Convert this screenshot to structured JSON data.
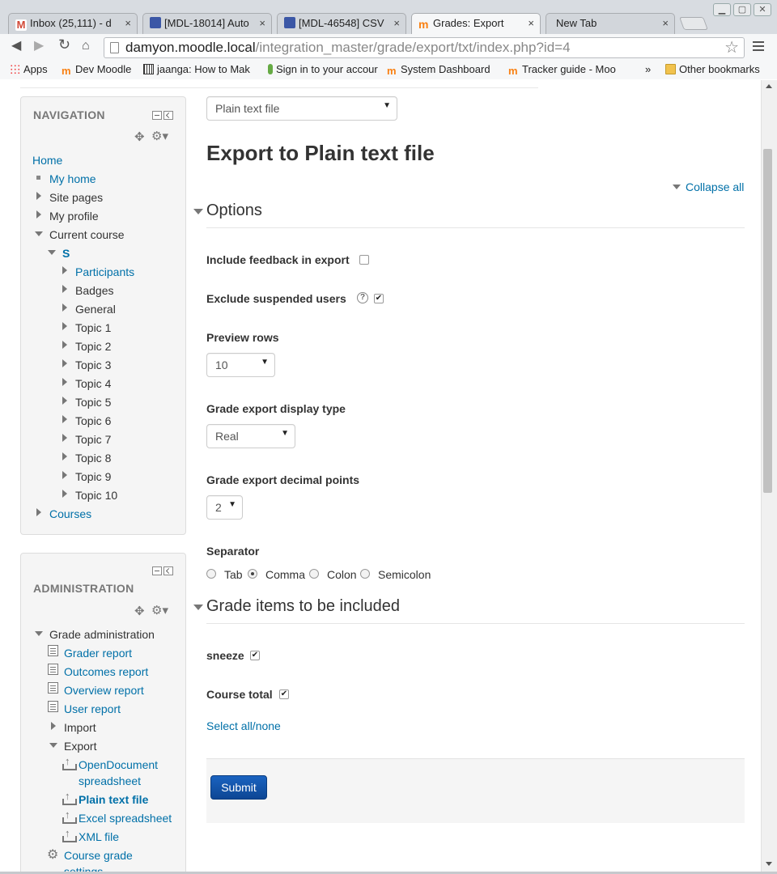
{
  "browser": {
    "tabs": [
      {
        "label": "Inbox (25,111) - d",
        "icon": "gmail-icon",
        "close": "×"
      },
      {
        "label": "[MDL-18014] Auto",
        "icon": "tracker-icon",
        "close": "×"
      },
      {
        "label": "[MDL-46548] CSV",
        "icon": "tracker-icon",
        "close": "×"
      },
      {
        "label": "Grades: Export",
        "icon": "moodle-icon",
        "close": "×"
      },
      {
        "label": "New Tab",
        "icon": "",
        "close": "×"
      }
    ],
    "url_host": "damyon.moodle.local",
    "url_path": "/integration_master/grade/export/txt/index.php?id=4",
    "bookmarks": [
      {
        "label": "Apps",
        "icon": "apps-icon"
      },
      {
        "label": "Dev Moodle",
        "icon": "moodle-icon"
      },
      {
        "label": "jaanga: How to Mak",
        "icon": "barcode-icon"
      },
      {
        "label": "Sign in to your accour",
        "icon": "key-icon"
      },
      {
        "label": "System Dashboard",
        "icon": "moodle-icon"
      },
      {
        "label": "Tracker guide - Moo",
        "icon": "moodle-icon"
      }
    ],
    "bookmarks_overflow": "»",
    "other_bookmarks": "Other bookmarks"
  },
  "navigation": {
    "title": "NAVIGATION",
    "home": "Home",
    "my_home": "My home",
    "site_pages": "Site pages",
    "my_profile": "My profile",
    "current_course": "Current course",
    "course_short": "S",
    "participants": "Participants",
    "badges": "Badges",
    "general": "General",
    "topics": [
      "Topic 1",
      "Topic 2",
      "Topic 3",
      "Topic 4",
      "Topic 5",
      "Topic 6",
      "Topic 7",
      "Topic 8",
      "Topic 9",
      "Topic 10"
    ],
    "courses": "Courses"
  },
  "administration": {
    "title": "ADMINISTRATION",
    "grade_administration": "Grade administration",
    "grader_report": "Grader report",
    "outcomes_report": "Outcomes report",
    "overview_report": "Overview report",
    "user_report": "User report",
    "import": "Import",
    "export": "Export",
    "opendocument_line1": "OpenDocument",
    "opendocument_line2": "spreadsheet",
    "plain_text_file": "Plain text file",
    "excel_spreadsheet": "Excel spreadsheet",
    "xml_file": "XML file",
    "course_grade_settings": "Course grade",
    "course_grade_settings_cut": "settings"
  },
  "main": {
    "export_format_select": "Plain text file",
    "heading": "Export to Plain text file",
    "collapse_all": "Collapse all",
    "options_legend": "Options",
    "include_feedback_label": "Include feedback in export",
    "include_feedback_checked": false,
    "exclude_suspended_label": "Exclude suspended users",
    "exclude_suspended_checked": true,
    "help_glyph": "?",
    "preview_rows_label": "Preview rows",
    "preview_rows_value": "10",
    "display_type_label": "Grade export display type",
    "display_type_value": "Real",
    "decimal_points_label": "Grade export decimal points",
    "decimal_points_value": "2",
    "separator_label": "Separator",
    "separator_options": [
      {
        "label": "Tab",
        "checked": false
      },
      {
        "label": "Comma",
        "checked": true
      },
      {
        "label": "Colon",
        "checked": false
      },
      {
        "label": "Semicolon",
        "checked": false
      }
    ],
    "grade_items_legend": "Grade items to be included",
    "grade_items": [
      {
        "label": "sneeze",
        "checked": true
      },
      {
        "label": "Course total",
        "checked": true
      }
    ],
    "select_all_none": "Select all/none",
    "submit_label": "Submit",
    "caret": "▼",
    "check_glyph": "✔"
  }
}
